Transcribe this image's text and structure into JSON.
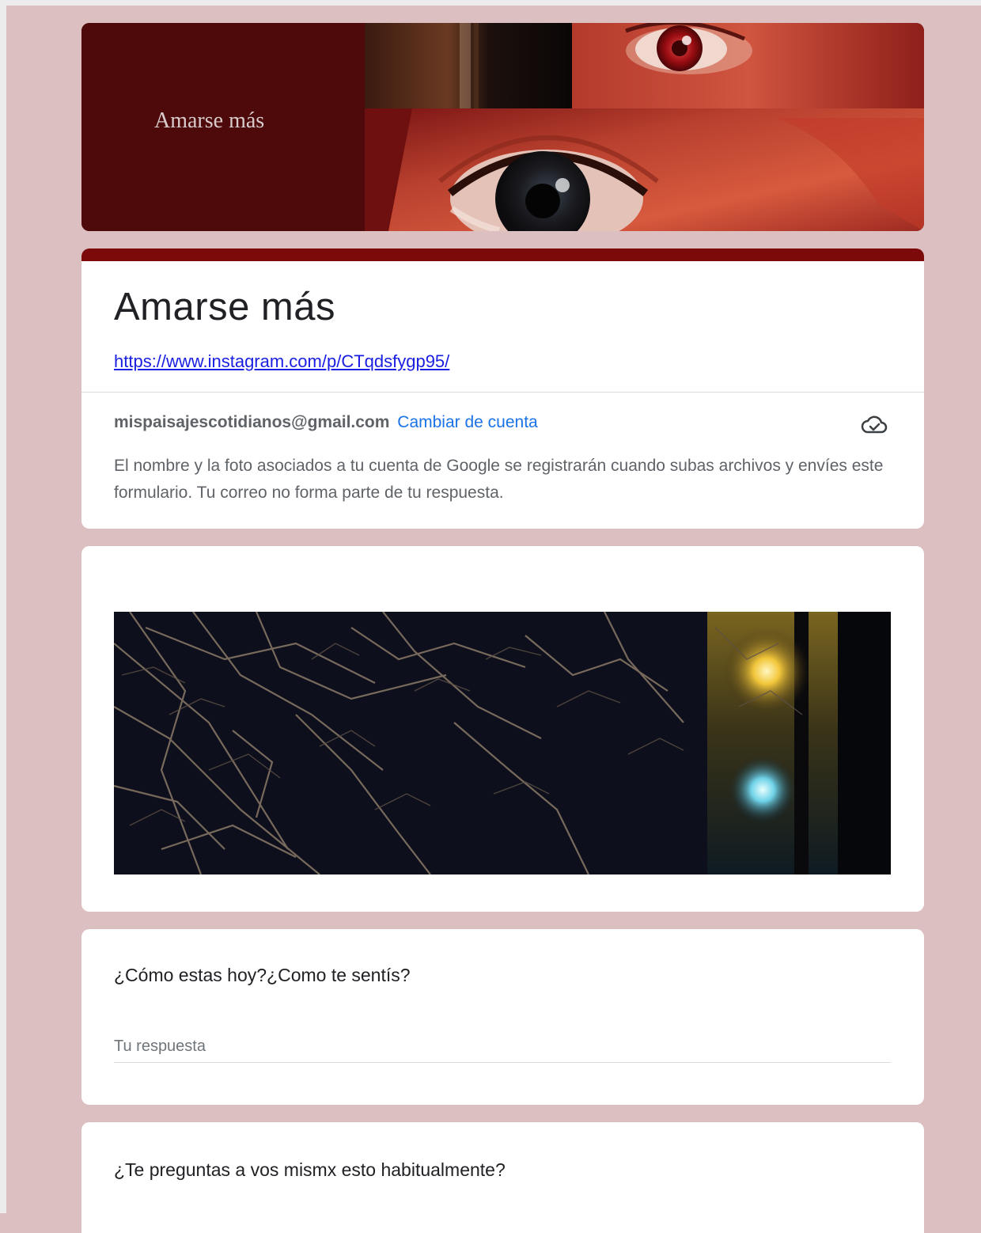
{
  "banner": {
    "text": "Amarse más",
    "image": "collage-eyes-photo"
  },
  "form": {
    "title": "Amarse más",
    "link": "https://www.instagram.com/p/CTqdsfygp95/"
  },
  "account": {
    "email": "mispaisajescotidianos@gmail.com",
    "switch_label": "Cambiar de cuenta",
    "icon": "cloud-sync-icon",
    "notice": "El nombre y la foto asociados a tu cuenta de Google se registrarán cuando subas archivos y envíes este formulario. Tu correo no forma parte de tu respuesta."
  },
  "image_card": {
    "image": "night-branches-photo"
  },
  "questions": [
    {
      "title": "¿Cómo estas hoy?¿Como te sentís?",
      "placeholder": "Tu respuesta"
    },
    {
      "title": "¿Te preguntas a vos mismx esto habitualmente?"
    }
  ],
  "colors": {
    "background": "#dcbfc1",
    "accent": "#7c0a0b",
    "link": "#1a1ee0",
    "switch_link": "#1a73e8"
  }
}
